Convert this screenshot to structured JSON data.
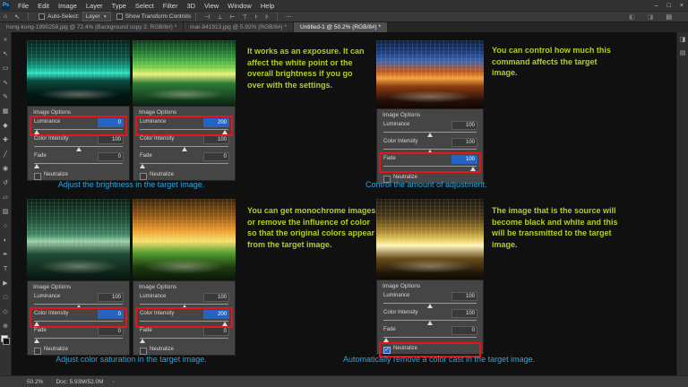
{
  "window": {
    "logo": "Ps"
  },
  "menubar": {
    "items": [
      "File",
      "Edit",
      "Image",
      "Layer",
      "Type",
      "Select",
      "Filter",
      "3D",
      "View",
      "Window",
      "Help"
    ]
  },
  "titlebar": {
    "controls": [
      "–",
      "□",
      "×"
    ]
  },
  "options_bar": {
    "home_icon": "⌂",
    "move_icon": "↖",
    "auto_select_label": "Auto-Select:",
    "layer_select_value": "Layer",
    "layer_caret": "▼",
    "show_transform_label": "Show Transform Controls",
    "align": [
      "⊣",
      "⊥",
      "⊢",
      "⊤",
      "⊦",
      "⊧"
    ],
    "more_icon": "⋯",
    "right_icons": [
      "◧",
      "◨",
      "▤"
    ]
  },
  "tabs": [
    {
      "title": "hong-kong-1990258.jpg @ 72.4% (Background copy 2, RGB/8#) *",
      "active": "false"
    },
    {
      "title": "mar-841913.jpg @ 5.92% (RGB/8#) *",
      "active": "false"
    },
    {
      "title": "Untitled-1 @ 50.2% (RGB/8#) *",
      "active": "true"
    }
  ],
  "tools": [
    {
      "name": "collapse-panels",
      "glyph": "»"
    },
    {
      "name": "move-tool",
      "glyph": "↖"
    },
    {
      "name": "marquee-tool",
      "glyph": "▭"
    },
    {
      "name": "lasso-tool",
      "glyph": "∿"
    },
    {
      "name": "quick-selection-tool",
      "glyph": "✎"
    },
    {
      "name": "crop-tool",
      "glyph": "▦"
    },
    {
      "name": "eyedropper-tool",
      "glyph": "◆"
    },
    {
      "name": "healing-brush-tool",
      "glyph": "✚"
    },
    {
      "name": "brush-tool",
      "glyph": "╱"
    },
    {
      "name": "clone-stamp-tool",
      "glyph": "◉"
    },
    {
      "name": "history-brush-tool",
      "glyph": "↺"
    },
    {
      "name": "eraser-tool",
      "glyph": "▱"
    },
    {
      "name": "gradient-tool",
      "glyph": "▨"
    },
    {
      "name": "blur-tool",
      "glyph": "○"
    },
    {
      "name": "dodge-tool",
      "glyph": "◐"
    },
    {
      "name": "pen-tool",
      "glyph": "✒"
    },
    {
      "name": "type-tool",
      "glyph": "T"
    },
    {
      "name": "path-selection-tool",
      "glyph": "▶"
    },
    {
      "name": "shape-tool",
      "glyph": "□"
    },
    {
      "name": "hand-tool",
      "glyph": "◇"
    },
    {
      "name": "zoom-tool",
      "glyph": "⊕"
    }
  ],
  "dock_icons": [
    "◨",
    "▤"
  ],
  "quadrants": [
    {
      "note": "It works as an exposure. It can affect the white point or the overall brightness if you go over with the settings.",
      "caption": "Adjust the brightness in the target image."
    },
    {
      "note": "You can control how much this command affects the target image.",
      "caption": "Control the amount of adjustment."
    },
    {
      "note": "You can get monochrome images or remove the influence of color so that the original colors appear from the target image.",
      "caption": "Adjust color saturation in the target image."
    },
    {
      "note": "The image that is the source will become black and white and this will be transmitted to the target image.",
      "caption": "Automatically remove a color cast in the target image."
    }
  ],
  "panels": [
    {
      "header": "Image Options",
      "rows": [
        {
          "label": "Luminance",
          "value": "0",
          "thumb": "left:3%",
          "hl": "true",
          "sel": "true"
        },
        {
          "label": "Color Intensity",
          "value": "100",
          "thumb": "left:50%",
          "hl": "false",
          "sel": "false"
        },
        {
          "label": "Fade",
          "value": "0",
          "thumb": "left:3%",
          "hl": "false",
          "sel": "false"
        }
      ],
      "neutralize": {
        "label": "Neutralize",
        "checked": "false",
        "hl": "false"
      }
    },
    {
      "header": "Image Options",
      "rows": [
        {
          "label": "Luminance",
          "value": "200",
          "thumb": "left:96%",
          "hl": "true",
          "sel": "true"
        },
        {
          "label": "Color Intensity",
          "value": "100",
          "thumb": "left:50%",
          "hl": "false",
          "sel": "false"
        },
        {
          "label": "Fade",
          "value": "0",
          "thumb": "left:3%",
          "hl": "false",
          "sel": "false"
        }
      ],
      "neutralize": {
        "label": "Neutralize",
        "checked": "false",
        "hl": "false"
      }
    },
    {
      "header": "Image Options",
      "rows": [
        {
          "label": "Luminance",
          "value": "100",
          "thumb": "left:50%",
          "hl": "false",
          "sel": "false"
        },
        {
          "label": "Color Intensity",
          "value": "100",
          "thumb": "left:50%",
          "hl": "false",
          "sel": "false"
        },
        {
          "label": "Fade",
          "value": "100",
          "thumb": "left:96%",
          "hl": "true",
          "sel": "true"
        }
      ],
      "neutralize": {
        "label": "Neutralize",
        "checked": "false",
        "hl": "false"
      }
    },
    {
      "header": "Image Options",
      "rows": [
        {
          "label": "Luminance",
          "value": "100",
          "thumb": "left:50%",
          "hl": "false",
          "sel": "false"
        },
        {
          "label": "Color Intensity",
          "value": "0",
          "thumb": "left:3%",
          "hl": "true",
          "sel": "true"
        },
        {
          "label": "Fade",
          "value": "0",
          "thumb": "left:3%",
          "hl": "false",
          "sel": "false"
        }
      ],
      "neutralize": {
        "label": "Neutralize",
        "checked": "false",
        "hl": "false"
      }
    },
    {
      "header": "Image Options",
      "rows": [
        {
          "label": "Luminance",
          "value": "100",
          "thumb": "left:50%",
          "hl": "false",
          "sel": "false"
        },
        {
          "label": "Color Intensity",
          "value": "200",
          "thumb": "left:96%",
          "hl": "true",
          "sel": "true"
        },
        {
          "label": "Fade",
          "value": "0",
          "thumb": "left:3%",
          "hl": "false",
          "sel": "false"
        }
      ],
      "neutralize": {
        "label": "Neutralize",
        "checked": "false",
        "hl": "false"
      }
    },
    {
      "header": "Image Options",
      "rows": [
        {
          "label": "Luminance",
          "value": "100",
          "thumb": "left:50%",
          "hl": "false",
          "sel": "false"
        },
        {
          "label": "Color Intensity",
          "value": "100",
          "thumb": "left:50%",
          "hl": "false",
          "sel": "false"
        },
        {
          "label": "Fade",
          "value": "0",
          "thumb": "left:3%",
          "hl": "false",
          "sel": "false"
        }
      ],
      "neutralize": {
        "label": "Neutralize",
        "checked": "true",
        "hl": "true"
      }
    }
  ],
  "status_bar": {
    "zoom": "50.2%",
    "doc": "Doc: 5.93M/52.0M",
    "chevron": "›"
  },
  "colors": {
    "note_text": "#b3cf1d",
    "caption_text": "#2ba7e0",
    "highlight_red": "#e81418",
    "selection_blue": "#2563c4"
  }
}
